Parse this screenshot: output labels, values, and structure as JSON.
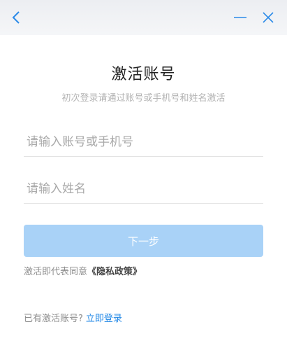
{
  "titlebar": {
    "back_icon": "chevron-left-icon",
    "minimize_icon": "minimize-icon",
    "close_icon": "close-icon",
    "icon_color": "#2b8ae8"
  },
  "main": {
    "title": "激活账号",
    "subtitle": "初次登录请通过账号或手机号和姓名激活",
    "account_placeholder": "请输入账号或手机号",
    "name_placeholder": "请输入姓名",
    "next_label": "下一步",
    "policy_prefix": "激活即代表同意",
    "policy_link": "《隐私政策》",
    "login_prefix": "已有激活账号?",
    "login_link": "立即登录"
  },
  "colors": {
    "button_bg": "#a9d2f7",
    "link": "#1e86e6",
    "titlebar_bg": "#eceef2"
  }
}
